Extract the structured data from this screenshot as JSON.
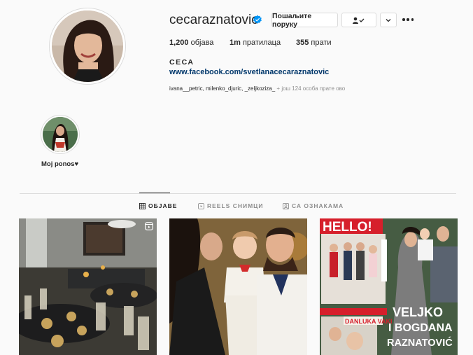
{
  "profile": {
    "username": "cecaraznatovic",
    "message_button": "Пошаљите поруку",
    "posts_count": "1,200",
    "posts_label": "објава",
    "followers_count": "1m",
    "followers_label": "пратилаца",
    "following_count": "355",
    "following_label": "прати",
    "full_name": "СЕСА",
    "website": "www.facebook.com/svetlanacecaraznatovic",
    "followed_by_names": "ivana__petric, milenko_djuric, _zeljkoziza_",
    "followed_by_more": "+ још 124 особа прате ово"
  },
  "highlights": [
    {
      "label": "Moj ponos♥"
    }
  ],
  "tabs": [
    {
      "label": "ОБЈАВЕ",
      "icon": "grid-icon",
      "active": true
    },
    {
      "label": "REELS СНИМЦИ",
      "icon": "reels-icon",
      "active": false
    },
    {
      "label": "СА ОЗНАКАМА",
      "icon": "tagged-icon",
      "active": false
    }
  ],
  "posts": [
    {
      "type": "reel",
      "icon": "reel-icon"
    },
    {
      "type": "photo"
    },
    {
      "type": "photo",
      "cover_masthead": "HELLO!",
      "cover_headline_1": "VELJKO",
      "cover_headline_2": "I BOGDANA",
      "cover_headline_3": "RAZNATOVIĆ",
      "cover_side": "DANLUKA VAKI"
    }
  ],
  "colors": {
    "background": "#fafafa",
    "link": "#00376b",
    "verified": "#0095f6",
    "muted": "#8e8e8e",
    "border": "#dbdbdb"
  }
}
